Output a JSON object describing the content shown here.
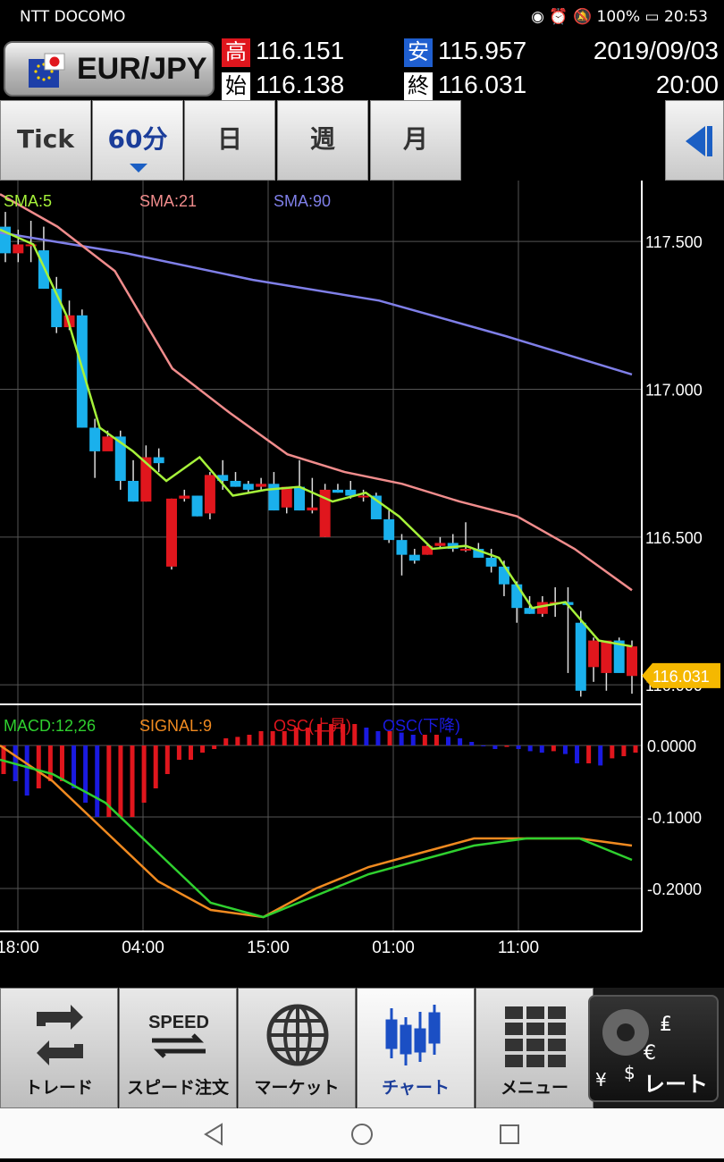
{
  "status": {
    "carrier": "NTT DOCOMO",
    "battery": "100%",
    "time": "20:53"
  },
  "header": {
    "pair": "EUR/JPY",
    "high_label": "高",
    "high": "116.151",
    "low_label": "安",
    "low": "115.957",
    "open_label": "始",
    "open": "116.138",
    "close_label": "終",
    "close": "116.031",
    "date": "2019/09/03",
    "time": "20:00"
  },
  "tabs": [
    {
      "label": "Tick"
    },
    {
      "label": "60分",
      "active": true
    },
    {
      "label": "日"
    },
    {
      "label": "週"
    },
    {
      "label": "月"
    }
  ],
  "bottom_nav": [
    {
      "label": "トレード",
      "icon": "trade-icon"
    },
    {
      "label": "スピード注文",
      "icon": "speed-icon",
      "icon_text": "SPEED"
    },
    {
      "label": "マーケット",
      "icon": "globe-icon"
    },
    {
      "label": "チャート",
      "icon": "candlestick-icon",
      "active": true
    },
    {
      "label": "メニュー",
      "icon": "grid-icon"
    },
    {
      "label": "レート",
      "icon": "currency-gear-icon"
    }
  ],
  "colors": {
    "up": "#e0161d",
    "down": "#1ab0ec",
    "sma5": "#a6f23a",
    "sma21": "#f08c8c",
    "sma90": "#7f7fe8",
    "macd": "#2fd02f",
    "signal": "#f08a20",
    "osc_up": "#e0161d",
    "osc_down": "#1a1ae0",
    "current_tag": "#f5b800"
  },
  "chart_data": [
    {
      "type": "candlestick",
      "title": "",
      "legend": [
        "SMA:5",
        "SMA:21",
        "SMA:90"
      ],
      "y_ticks": [
        "117.500",
        "117.000",
        "116.500",
        "116.000"
      ],
      "ylim": [
        115.94,
        117.7
      ],
      "current_price": "116.031",
      "x_ticks": [
        "18:00",
        "04:00",
        "15:00",
        "01:00",
        "11:00"
      ],
      "candles": [
        [
          117.55,
          117.6,
          117.43,
          117.46
        ],
        [
          117.46,
          117.54,
          117.43,
          117.49
        ],
        [
          117.49,
          117.57,
          117.43,
          117.49
        ],
        [
          117.47,
          117.55,
          117.34,
          117.34
        ],
        [
          117.34,
          117.38,
          117.19,
          117.21
        ],
        [
          117.21,
          117.3,
          117.2,
          117.25
        ],
        [
          117.25,
          117.27,
          116.87,
          116.87
        ],
        [
          116.87,
          116.9,
          116.7,
          116.79
        ],
        [
          116.79,
          116.86,
          116.84,
          116.84
        ],
        [
          116.84,
          116.86,
          116.66,
          116.69
        ],
        [
          116.69,
          116.76,
          116.62,
          116.62
        ],
        [
          116.62,
          116.81,
          116.62,
          116.77
        ],
        [
          116.77,
          116.8,
          116.72,
          116.75
        ],
        [
          116.4,
          116.63,
          116.39,
          116.63
        ],
        [
          116.63,
          116.66,
          116.62,
          116.64
        ],
        [
          116.64,
          116.64,
          116.57,
          116.57
        ],
        [
          116.58,
          116.72,
          116.56,
          116.71
        ],
        [
          116.71,
          116.76,
          116.66,
          116.69
        ],
        [
          116.69,
          116.72,
          116.67,
          116.67
        ],
        [
          116.68,
          116.69,
          116.65,
          116.66
        ],
        [
          116.67,
          116.7,
          116.66,
          116.68
        ],
        [
          116.68,
          116.72,
          116.59,
          116.59
        ],
        [
          116.6,
          116.67,
          116.58,
          116.67
        ],
        [
          116.67,
          116.76,
          116.59,
          116.59
        ],
        [
          116.59,
          116.7,
          116.58,
          116.6
        ],
        [
          116.5,
          116.68,
          116.5,
          116.66
        ],
        [
          116.66,
          116.68,
          116.65,
          116.65
        ],
        [
          116.66,
          116.69,
          116.63,
          116.64
        ],
        [
          116.64,
          116.66,
          116.62,
          116.64
        ],
        [
          116.64,
          116.65,
          116.56,
          116.56
        ],
        [
          116.56,
          116.59,
          116.48,
          116.49
        ],
        [
          116.49,
          116.51,
          116.37,
          116.44
        ],
        [
          116.44,
          116.46,
          116.41,
          116.42
        ],
        [
          116.44,
          116.48,
          116.44,
          116.47
        ],
        [
          116.47,
          116.5,
          116.46,
          116.48
        ],
        [
          116.48,
          116.51,
          116.45,
          116.46
        ],
        [
          116.46,
          116.55,
          116.45,
          116.46
        ],
        [
          116.46,
          116.48,
          116.43,
          116.43
        ],
        [
          116.43,
          116.46,
          116.38,
          116.4
        ],
        [
          116.4,
          116.42,
          116.3,
          116.34
        ],
        [
          116.34,
          116.35,
          116.21,
          116.26
        ],
        [
          116.26,
          116.3,
          116.24,
          116.24
        ],
        [
          116.24,
          116.3,
          116.23,
          116.28
        ],
        [
          116.28,
          116.33,
          116.23,
          116.28
        ],
        [
          116.28,
          116.33,
          116.04,
          116.27
        ],
        [
          116.21,
          116.25,
          115.96,
          115.98
        ],
        [
          116.06,
          116.16,
          116.01,
          116.15
        ],
        [
          116.04,
          116.14,
          115.98,
          116.15
        ],
        [
          116.15,
          116.16,
          116.06,
          116.04
        ],
        [
          116.03,
          116.15,
          115.97,
          116.13
        ]
      ],
      "sma5": [
        [
          117.54,
          117.47
        ],
        [
          117.49,
          117.46
        ],
        [
          117.25,
          117.44
        ],
        [
          116.87,
          117.24
        ],
        [
          116.79,
          117.06
        ],
        [
          116.69,
          116.82
        ],
        [
          116.77,
          116.77
        ],
        [
          116.64,
          116.7
        ],
        [
          116.66,
          116.66
        ],
        [
          116.67,
          116.68
        ],
        [
          116.62,
          116.64
        ],
        [
          116.65,
          116.63
        ],
        [
          116.57,
          116.59
        ],
        [
          116.46,
          116.52
        ],
        [
          116.47,
          116.48
        ],
        [
          116.43,
          116.45
        ],
        [
          116.26,
          116.34
        ],
        [
          116.28,
          116.29
        ],
        [
          116.15,
          116.24
        ],
        [
          116.13,
          116.09
        ]
      ],
      "sma21": [
        [
          117.66,
          117.64
        ],
        [
          117.55,
          117.6
        ],
        [
          117.4,
          117.48
        ],
        [
          117.07,
          117.1
        ],
        [
          116.92,
          116.89
        ],
        [
          116.78,
          116.79
        ],
        [
          116.72,
          116.73
        ],
        [
          116.68,
          116.67
        ],
        [
          116.62,
          116.61
        ],
        [
          116.57,
          116.56
        ],
        [
          116.46,
          116.44
        ],
        [
          116.32,
          116.31
        ]
      ],
      "sma90": [
        [
          117.53,
          117.52
        ],
        [
          117.46,
          117.47
        ],
        [
          117.37,
          117.4
        ],
        [
          117.3,
          117.32
        ],
        [
          117.18,
          117.21
        ],
        [
          117.05,
          117.07
        ]
      ]
    },
    {
      "type": "bar+line",
      "title": "",
      "legend": [
        "MACD:12,26",
        "SIGNAL:9",
        "OSC(上昇)",
        "OSC(下降)"
      ],
      "y_ticks": [
        "0.0000",
        "-0.1000",
        "-0.2000"
      ],
      "ylim": [
        -0.26,
        0.055
      ],
      "osc": [
        -0.04,
        -0.05,
        -0.07,
        -0.06,
        -0.05,
        -0.05,
        -0.06,
        -0.08,
        -0.1,
        -0.1,
        -0.1,
        -0.1,
        -0.08,
        -0.06,
        -0.04,
        -0.02,
        -0.02,
        -0.01,
        -0.005,
        0.01,
        0.012,
        0.015,
        0.02,
        0.02,
        0.02,
        0.025,
        0.025,
        0.03,
        0.03,
        0.03,
        0.03,
        0.025,
        0.02,
        0.02,
        0.018,
        0.015,
        0.015,
        0.015,
        0.012,
        0.01,
        0.005,
        0.0,
        -0.005,
        -0.002,
        -0.005,
        -0.008,
        -0.01,
        -0.008,
        -0.012,
        -0.025,
        -0.025,
        -0.028,
        -0.018,
        -0.015,
        -0.01
      ],
      "macd": [
        [
          -0.02,
          -0.02
        ],
        [
          -0.04,
          -0.05
        ],
        [
          -0.08,
          -0.09
        ],
        [
          -0.15,
          -0.16
        ],
        [
          -0.22,
          -0.23
        ],
        [
          -0.24,
          -0.25
        ],
        [
          -0.21,
          -0.23
        ],
        [
          -0.18,
          -0.19
        ],
        [
          -0.16,
          -0.16
        ],
        [
          -0.14,
          -0.13
        ],
        [
          -0.13,
          -0.12
        ],
        [
          -0.13,
          -0.15
        ],
        [
          -0.16,
          -0.16
        ]
      ],
      "signal": [
        [
          0.0,
          -0.01
        ],
        [
          -0.05,
          -0.06
        ],
        [
          -0.12,
          -0.13
        ],
        [
          -0.19,
          -0.2
        ],
        [
          -0.23,
          -0.24
        ],
        [
          -0.24,
          -0.23
        ],
        [
          -0.2,
          -0.21
        ],
        [
          -0.17,
          -0.18
        ],
        [
          -0.15,
          -0.16
        ],
        [
          -0.13,
          -0.14
        ],
        [
          -0.13,
          -0.13
        ],
        [
          -0.13,
          -0.13
        ],
        [
          -0.14,
          -0.15
        ]
      ]
    }
  ]
}
